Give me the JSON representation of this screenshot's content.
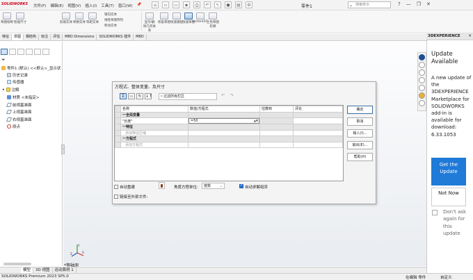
{
  "app": {
    "logo_text": "SOLIDWORKS",
    "doc_title": "零件1",
    "menu": [
      "文件(F)",
      "编辑(E)",
      "视图(V)",
      "插入(I)",
      "工具(T)",
      "窗口(W)"
    ],
    "menu_pin": "📌",
    "search_placeholder": "搜索命令",
    "window_controls": [
      "?",
      "—",
      "❐",
      "✕"
    ]
  },
  "ribbon": {
    "buttons": [
      "草图绘制",
      "智能尺寸",
      "剪裁实体",
      "转换实体",
      "等距实体",
      "显示/删除几何关系",
      "修复草图",
      "快速捕捉",
      "快速草图",
      "Instant2D",
      "上色草图轮廓"
    ],
    "small_labels": [
      "镜向实体",
      "线性草图阵列",
      "移动实体"
    ]
  },
  "cmd_tabs": [
    "特征",
    "草图",
    "钢结构",
    "标注",
    "评估",
    "MBD Dimensions",
    "SOLIDWORKS 插件",
    "MBD"
  ],
  "tree": {
    "root": "零件1 (默认) <<默认>_显示状",
    "items": [
      "历史记录",
      "传感器",
      "注解",
      "材质 <未指定>",
      "前视基准面",
      "上视基准面",
      "右视基准面",
      "原点"
    ]
  },
  "view": {
    "name": "*等轴测"
  },
  "bottom_tabs": [
    "模型",
    "3D 视图",
    "运动算例 1"
  ],
  "status": {
    "left": "SOLIDWORKS Premium 2023 SP5.0",
    "mid": "在编辑 零件",
    "right": "自定义"
  },
  "right_panel": {
    "header": "3DEXPERIENCE",
    "close": "✕",
    "update_title": "Update Available",
    "update_msg": "A new update of the 3DEXPERIENCE Marketplace for SOLIDWORKS add-in is available for download: 6.33.1053",
    "get_button": "Get the Update",
    "notnow_button": "Not Now",
    "dontask_label": "Don't ask again for this update"
  },
  "dialog": {
    "title": "方程式、整体变量、及尺寸",
    "filter_placeholder": "▿ 过滤所有栏区",
    "toolbar_icons": [
      "Σ",
      "▭",
      "↻",
      "↓↑"
    ],
    "undo_redo": "↶ ↷",
    "columns": [
      "名称",
      "数值/方程式",
      "估算到",
      "评论"
    ],
    "groups": [
      {
        "label": "一全局变量",
        "rows": [
          {
            "name": "\"长度\"",
            "value": "=50",
            "is_input": true
          }
        ]
      },
      {
        "label": "一特征",
        "rows": [
          {
            "name": "添加特征压缩",
            "value": "",
            "placeholder": true
          }
        ]
      },
      {
        "label": "一方程式",
        "rows": [
          {
            "name": "添加方程式",
            "value": "",
            "placeholder": true
          }
        ]
      }
    ],
    "buttons": {
      "ok": "确定",
      "cancel": "取消",
      "import": "输入(I)...",
      "export": "输出(E)...",
      "help": "帮助(H)"
    },
    "auto_rebuild": "自动重建",
    "angle_label": "角度方程单位:",
    "angle_value": "度数",
    "auto_solve": "自动求解组序",
    "link_external": "链接至外部文件:"
  }
}
